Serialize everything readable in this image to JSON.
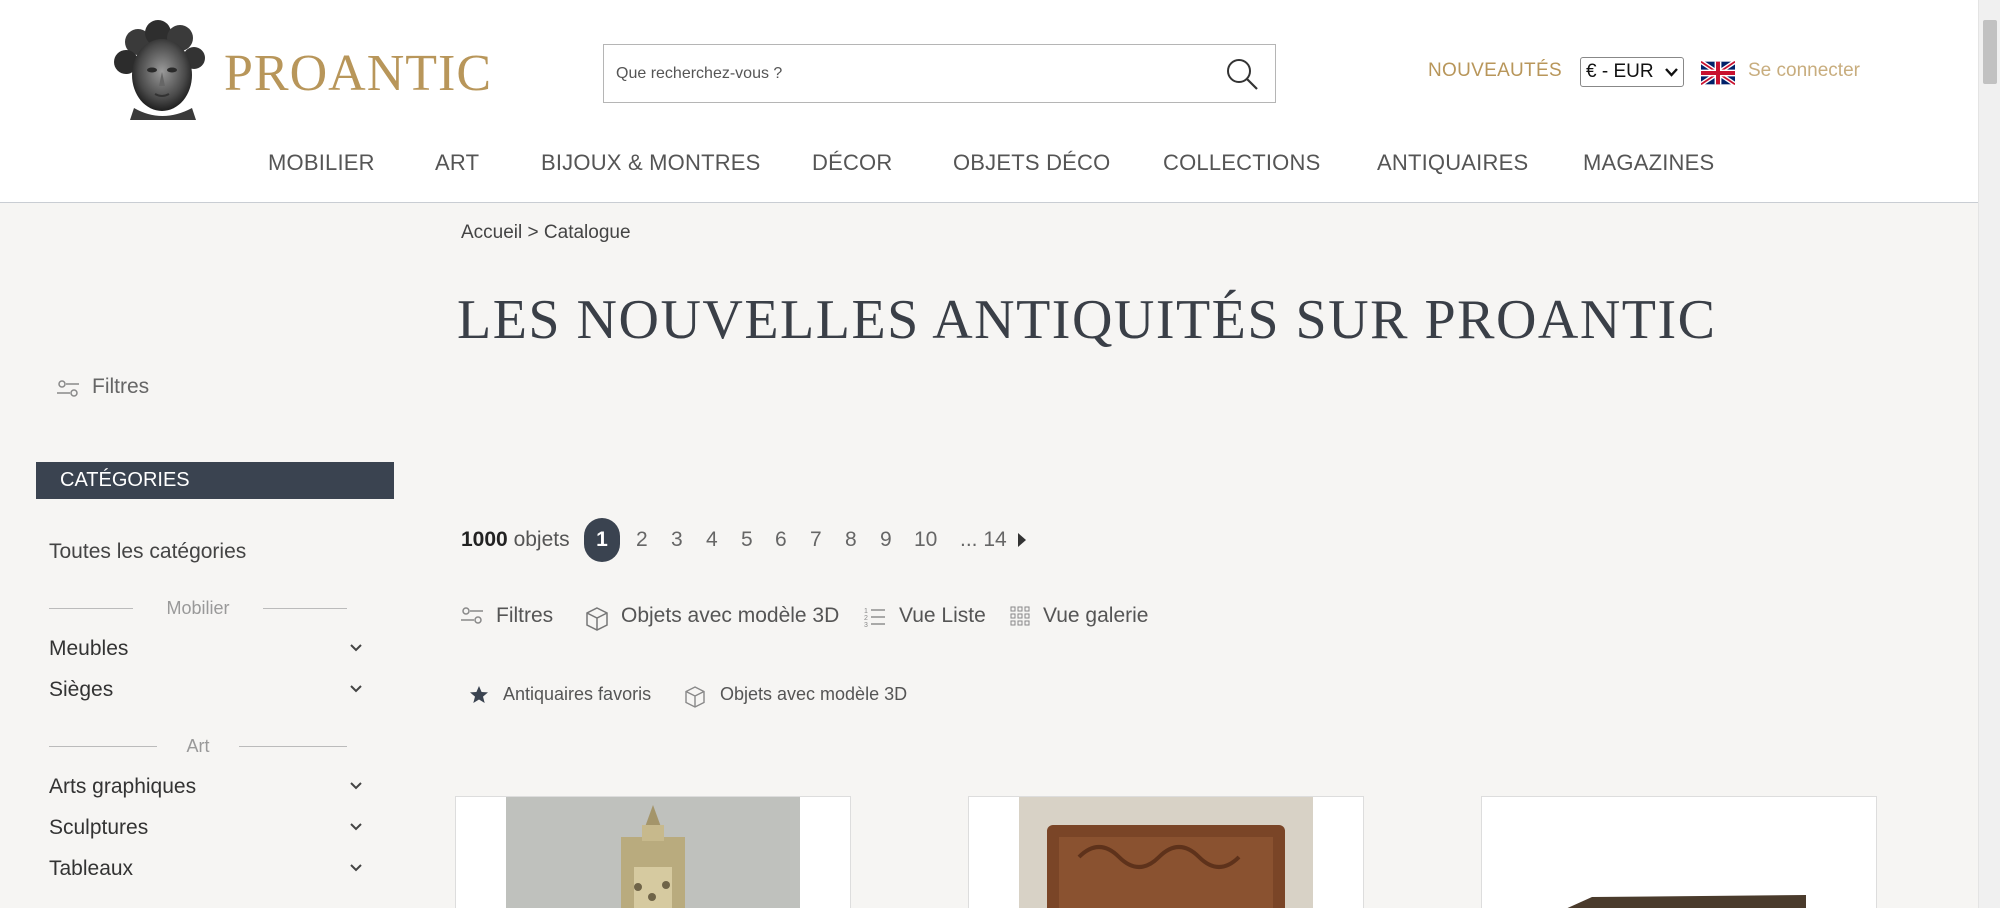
{
  "header": {
    "logo_text": "PROANTIC",
    "search_placeholder": "Que recherchez-vous ?",
    "new_label": "NOUVEAUTÉS",
    "currency": "€ - EUR",
    "login_label": "Se connecter"
  },
  "nav": [
    "MOBILIER",
    "ART",
    "BIJOUX & MONTRES",
    "DÉCOR",
    "OBJETS DÉCO",
    "COLLECTIONS",
    "ANTIQUAIRES",
    "MAGAZINES"
  ],
  "sidebar": {
    "filters_label": "Filtres",
    "categories_title": "CATÉGORIES",
    "all_categories": "Toutes les catégories",
    "groups": [
      {
        "label": "Mobilier",
        "items": [
          "Meubles",
          "Sièges"
        ]
      },
      {
        "label": "Art",
        "items": [
          "Arts graphiques",
          "Sculptures",
          "Tableaux"
        ]
      }
    ]
  },
  "breadcrumb": {
    "home": "Accueil",
    "separator": ">",
    "current": "Catalogue"
  },
  "page_title": "LES NOUVELLES ANTIQUITÉS SUR PROANTIC",
  "results": {
    "count": "1000",
    "count_suffix": "objets",
    "current_page": "1",
    "pages": [
      "2",
      "3",
      "4",
      "5",
      "6",
      "7",
      "8",
      "9",
      "10",
      "... 14"
    ]
  },
  "toolbar": {
    "filters": "Filtres",
    "models3d": "Objets avec modèle 3D",
    "list_view": "Vue Liste",
    "gallery_view": "Vue galerie"
  },
  "chips": {
    "favorites": "Antiquaires favoris",
    "models3d": "Objets avec modèle 3D"
  },
  "colors": {
    "gold": "#b8965a",
    "dark": "#3a4350",
    "background": "#f6f5f3"
  }
}
